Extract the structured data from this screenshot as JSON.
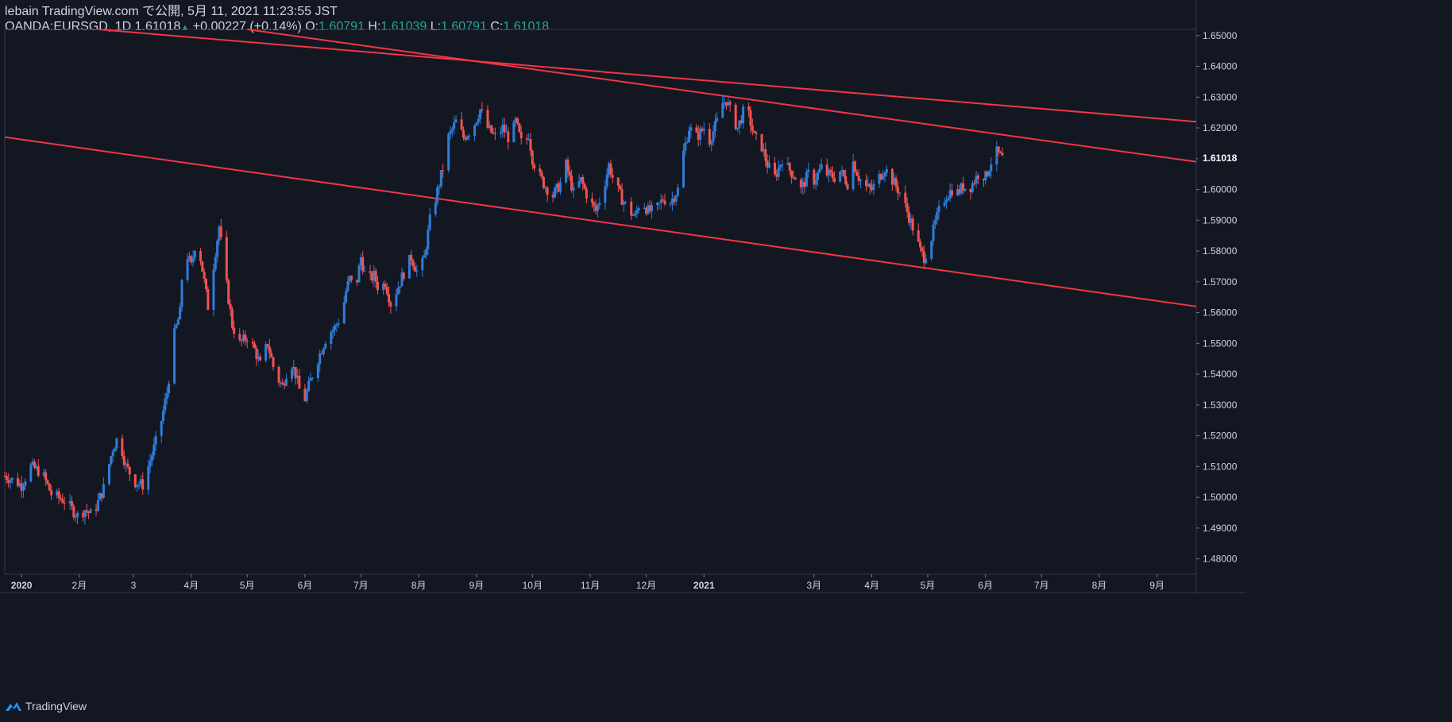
{
  "header": {
    "line1": "lebain TradingView.com で公開, 5月 11, 2021 11:23:55 JST",
    "symbol": "OANDA:EURSGD, 1D",
    "last": "1.61018",
    "change": "+0.00227 (+0.14%)",
    "o_label": "O:",
    "o_value": "1.60791",
    "h_label": "H:",
    "h_value": "1.61039",
    "l_label": "L:",
    "l_value": "1.60791",
    "c_label": "C:",
    "c_value": "1.61018"
  },
  "footer": {
    "brand": "TradingView"
  },
  "colors": {
    "background": "#131722",
    "up_candle": "#2e7dd8",
    "down_candle": "#ef5350",
    "trendline": "#f23645",
    "axis_text": "#d1d4dc",
    "last_price_bg": "#131722"
  },
  "chart_data": {
    "type": "candlestick",
    "title": "",
    "ylim": [
      1.475,
      1.652
    ],
    "y_ticks": [
      "1.65000",
      "1.64000",
      "1.63000",
      "1.62000",
      "1.61000",
      "1.60000",
      "1.59000",
      "1.58000",
      "1.57000",
      "1.56000",
      "1.55000",
      "1.54000",
      "1.53000",
      "1.52000",
      "1.51000",
      "1.50000",
      "1.49000",
      "1.48000"
    ],
    "last_price_label": "1.61018",
    "x_range": [
      "2019-12-23",
      "2021-09-22"
    ],
    "x_ticks": [
      {
        "date": "2020-01-01",
        "label": "2020",
        "bold": true
      },
      {
        "date": "2020-02-01",
        "label": "2月"
      },
      {
        "date": "2020-03-01",
        "label": "3"
      },
      {
        "date": "2020-04-01",
        "label": "4月"
      },
      {
        "date": "2020-05-01",
        "label": "5月"
      },
      {
        "date": "2020-06-01",
        "label": "6月"
      },
      {
        "date": "2020-07-01",
        "label": "7月"
      },
      {
        "date": "2020-08-01",
        "label": "8月"
      },
      {
        "date": "2020-09-01",
        "label": "9月"
      },
      {
        "date": "2020-10-01",
        "label": "10月"
      },
      {
        "date": "2020-11-01",
        "label": "11月"
      },
      {
        "date": "2020-12-01",
        "label": "12月"
      },
      {
        "date": "2021-01-01",
        "label": "2021",
        "bold": true
      },
      {
        "date": "2021-03-01",
        "label": "3月"
      },
      {
        "date": "2021-04-01",
        "label": "4月"
      },
      {
        "date": "2021-05-01",
        "label": "5月"
      },
      {
        "date": "2021-06-01",
        "label": "6月"
      },
      {
        "date": "2021-07-01",
        "label": "7月"
      },
      {
        "date": "2021-08-01",
        "label": "8月"
      },
      {
        "date": "2021-09-01",
        "label": "9月"
      }
    ],
    "price_path": [
      [
        "2019-12-23",
        1.507
      ],
      [
        "2020-01-01",
        1.504
      ],
      [
        "2020-01-06",
        1.51
      ],
      [
        "2020-01-12",
        1.508
      ],
      [
        "2020-01-17",
        1.501
      ],
      [
        "2020-01-24",
        1.499
      ],
      [
        "2020-01-31",
        1.494
      ],
      [
        "2020-02-04",
        1.496
      ],
      [
        "2020-02-08",
        1.494
      ],
      [
        "2020-02-14",
        1.503
      ],
      [
        "2020-02-19",
        1.516
      ],
      [
        "2020-02-22",
        1.52
      ],
      [
        "2020-02-26",
        1.51
      ],
      [
        "2020-03-02",
        1.505
      ],
      [
        "2020-03-06",
        1.504
      ],
      [
        "2020-03-10",
        1.512
      ],
      [
        "2020-03-15",
        1.522
      ],
      [
        "2020-03-19",
        1.534
      ],
      [
        "2020-03-23",
        1.553
      ],
      [
        "2020-03-26",
        1.56
      ],
      [
        "2020-03-28",
        1.582
      ],
      [
        "2020-04-01",
        1.575
      ],
      [
        "2020-04-04",
        1.585
      ],
      [
        "2020-04-07",
        1.574
      ],
      [
        "2020-04-10",
        1.562
      ],
      [
        "2020-04-14",
        1.58
      ],
      [
        "2020-04-16",
        1.588
      ],
      [
        "2020-04-19",
        1.573
      ],
      [
        "2020-04-23",
        1.556
      ],
      [
        "2020-04-27",
        1.55
      ],
      [
        "2020-05-01",
        1.552
      ],
      [
        "2020-05-05",
        1.548
      ],
      [
        "2020-05-08",
        1.543
      ],
      [
        "2020-05-12",
        1.55
      ],
      [
        "2020-05-16",
        1.54
      ],
      [
        "2020-05-20",
        1.536
      ],
      [
        "2020-05-24",
        1.545
      ],
      [
        "2020-05-27",
        1.54
      ],
      [
        "2020-05-31",
        1.53
      ],
      [
        "2020-06-04",
        1.538
      ],
      [
        "2020-06-08",
        1.545
      ],
      [
        "2020-06-13",
        1.553
      ],
      [
        "2020-06-17",
        1.555
      ],
      [
        "2020-06-21",
        1.56
      ],
      [
        "2020-06-23",
        1.567
      ],
      [
        "2020-06-25",
        1.571
      ],
      [
        "2020-06-28",
        1.567
      ],
      [
        "2020-07-01",
        1.578
      ],
      [
        "2020-07-04",
        1.57
      ],
      [
        "2020-07-08",
        1.572
      ],
      [
        "2020-07-11",
        1.567
      ],
      [
        "2020-07-14",
        1.57
      ],
      [
        "2020-07-17",
        1.563
      ],
      [
        "2020-07-20",
        1.567
      ],
      [
        "2020-07-24",
        1.573
      ],
      [
        "2020-07-28",
        1.578
      ],
      [
        "2020-08-01",
        1.572
      ],
      [
        "2020-08-04",
        1.578
      ],
      [
        "2020-08-07",
        1.59
      ],
      [
        "2020-08-10",
        1.597
      ],
      [
        "2020-08-14",
        1.607
      ],
      [
        "2020-08-17",
        1.617
      ],
      [
        "2020-08-21",
        1.622
      ],
      [
        "2020-08-25",
        1.617
      ],
      [
        "2020-08-30",
        1.62
      ],
      [
        "2020-09-03",
        1.626
      ],
      [
        "2020-09-07",
        1.62
      ],
      [
        "2020-09-11",
        1.617
      ],
      [
        "2020-09-15",
        1.62
      ],
      [
        "2020-09-19",
        1.616
      ],
      [
        "2020-09-22",
        1.622
      ],
      [
        "2020-09-26",
        1.613
      ],
      [
        "2020-09-29",
        1.618
      ],
      [
        "2020-10-01",
        1.61
      ],
      [
        "2020-10-04",
        1.605
      ],
      [
        "2020-10-08",
        1.601
      ],
      [
        "2020-10-12",
        1.598
      ],
      [
        "2020-10-16",
        1.602
      ],
      [
        "2020-10-19",
        1.608
      ],
      [
        "2020-10-23",
        1.599
      ],
      [
        "2020-10-27",
        1.603
      ],
      [
        "2020-10-31",
        1.597
      ],
      [
        "2020-11-04",
        1.593
      ],
      [
        "2020-11-08",
        1.6
      ],
      [
        "2020-11-11",
        1.608
      ],
      [
        "2020-11-14",
        1.602
      ],
      [
        "2020-11-18",
        1.597
      ],
      [
        "2020-11-22",
        1.593
      ],
      [
        "2020-11-25",
        1.591
      ],
      [
        "2020-11-28",
        1.597
      ],
      [
        "2020-12-02",
        1.593
      ],
      [
        "2020-12-06",
        1.593
      ],
      [
        "2020-12-10",
        1.597
      ],
      [
        "2020-12-14",
        1.596
      ],
      [
        "2020-12-18",
        1.6
      ],
      [
        "2020-12-21",
        1.612
      ],
      [
        "2020-12-24",
        1.62
      ],
      [
        "2020-12-28",
        1.617
      ],
      [
        "2021-01-01",
        1.62
      ],
      [
        "2021-01-04",
        1.616
      ],
      [
        "2021-01-08",
        1.622
      ],
      [
        "2021-01-11",
        1.628
      ],
      [
        "2021-01-13",
        1.629
      ],
      [
        "2021-01-16",
        1.624
      ],
      [
        "2021-01-19",
        1.62
      ],
      [
        "2021-01-22",
        1.625
      ],
      [
        "2021-01-25",
        1.624
      ],
      [
        "2021-01-28",
        1.617
      ],
      [
        "2021-02-01",
        1.614
      ],
      [
        "2021-02-04",
        1.608
      ],
      [
        "2021-02-08",
        1.604
      ],
      [
        "2021-02-12",
        1.61
      ],
      [
        "2021-02-15",
        1.607
      ],
      [
        "2021-02-19",
        1.604
      ],
      [
        "2021-02-22",
        1.6
      ],
      [
        "2021-02-26",
        1.605
      ],
      [
        "2021-03-01",
        1.603
      ],
      [
        "2021-03-05",
        1.607
      ],
      [
        "2021-03-08",
        1.605
      ],
      [
        "2021-03-12",
        1.604
      ],
      [
        "2021-03-15",
        1.606
      ],
      [
        "2021-03-19",
        1.602
      ],
      [
        "2021-03-22",
        1.609
      ],
      [
        "2021-03-25",
        1.604
      ],
      [
        "2021-03-28",
        1.601
      ],
      [
        "2021-04-01",
        1.6
      ],
      [
        "2021-04-04",
        1.603
      ],
      [
        "2021-04-08",
        1.607
      ],
      [
        "2021-04-11",
        1.604
      ],
      [
        "2021-04-14",
        1.601
      ],
      [
        "2021-04-17",
        1.598
      ],
      [
        "2021-04-21",
        1.591
      ],
      [
        "2021-04-24",
        1.586
      ],
      [
        "2021-04-27",
        1.58
      ],
      [
        "2021-04-29",
        1.578
      ],
      [
        "2021-05-02",
        1.582
      ],
      [
        "2021-05-05",
        1.589
      ],
      [
        "2021-05-08",
        1.595
      ],
      [
        "2021-05-11",
        1.598
      ],
      [
        "2021-05-14",
        1.6
      ],
      [
        "2021-05-17",
        1.599
      ],
      [
        "2021-05-20",
        1.601
      ],
      [
        "2021-05-23",
        1.6
      ],
      [
        "2021-05-26",
        1.603
      ],
      [
        "2021-05-29",
        1.606
      ],
      [
        "2021-06-01",
        1.604
      ],
      [
        "2021-06-04",
        1.609
      ],
      [
        "2021-06-07",
        1.612
      ],
      [
        "2021-06-10",
        1.61
      ]
    ],
    "trendlines": [
      {
        "name": "upper-trendline-1",
        "from": [
          "2020-02-11",
          1.652
        ],
        "to": [
          "2021-09-22",
          1.622
        ]
      },
      {
        "name": "upper-trendline-2",
        "from": [
          "2020-05-01",
          1.652
        ],
        "to": [
          "2021-09-22",
          1.609
        ]
      },
      {
        "name": "lower-trendline",
        "from": [
          "2019-12-23",
          1.617
        ],
        "to": [
          "2021-09-22",
          1.562
        ]
      }
    ]
  }
}
